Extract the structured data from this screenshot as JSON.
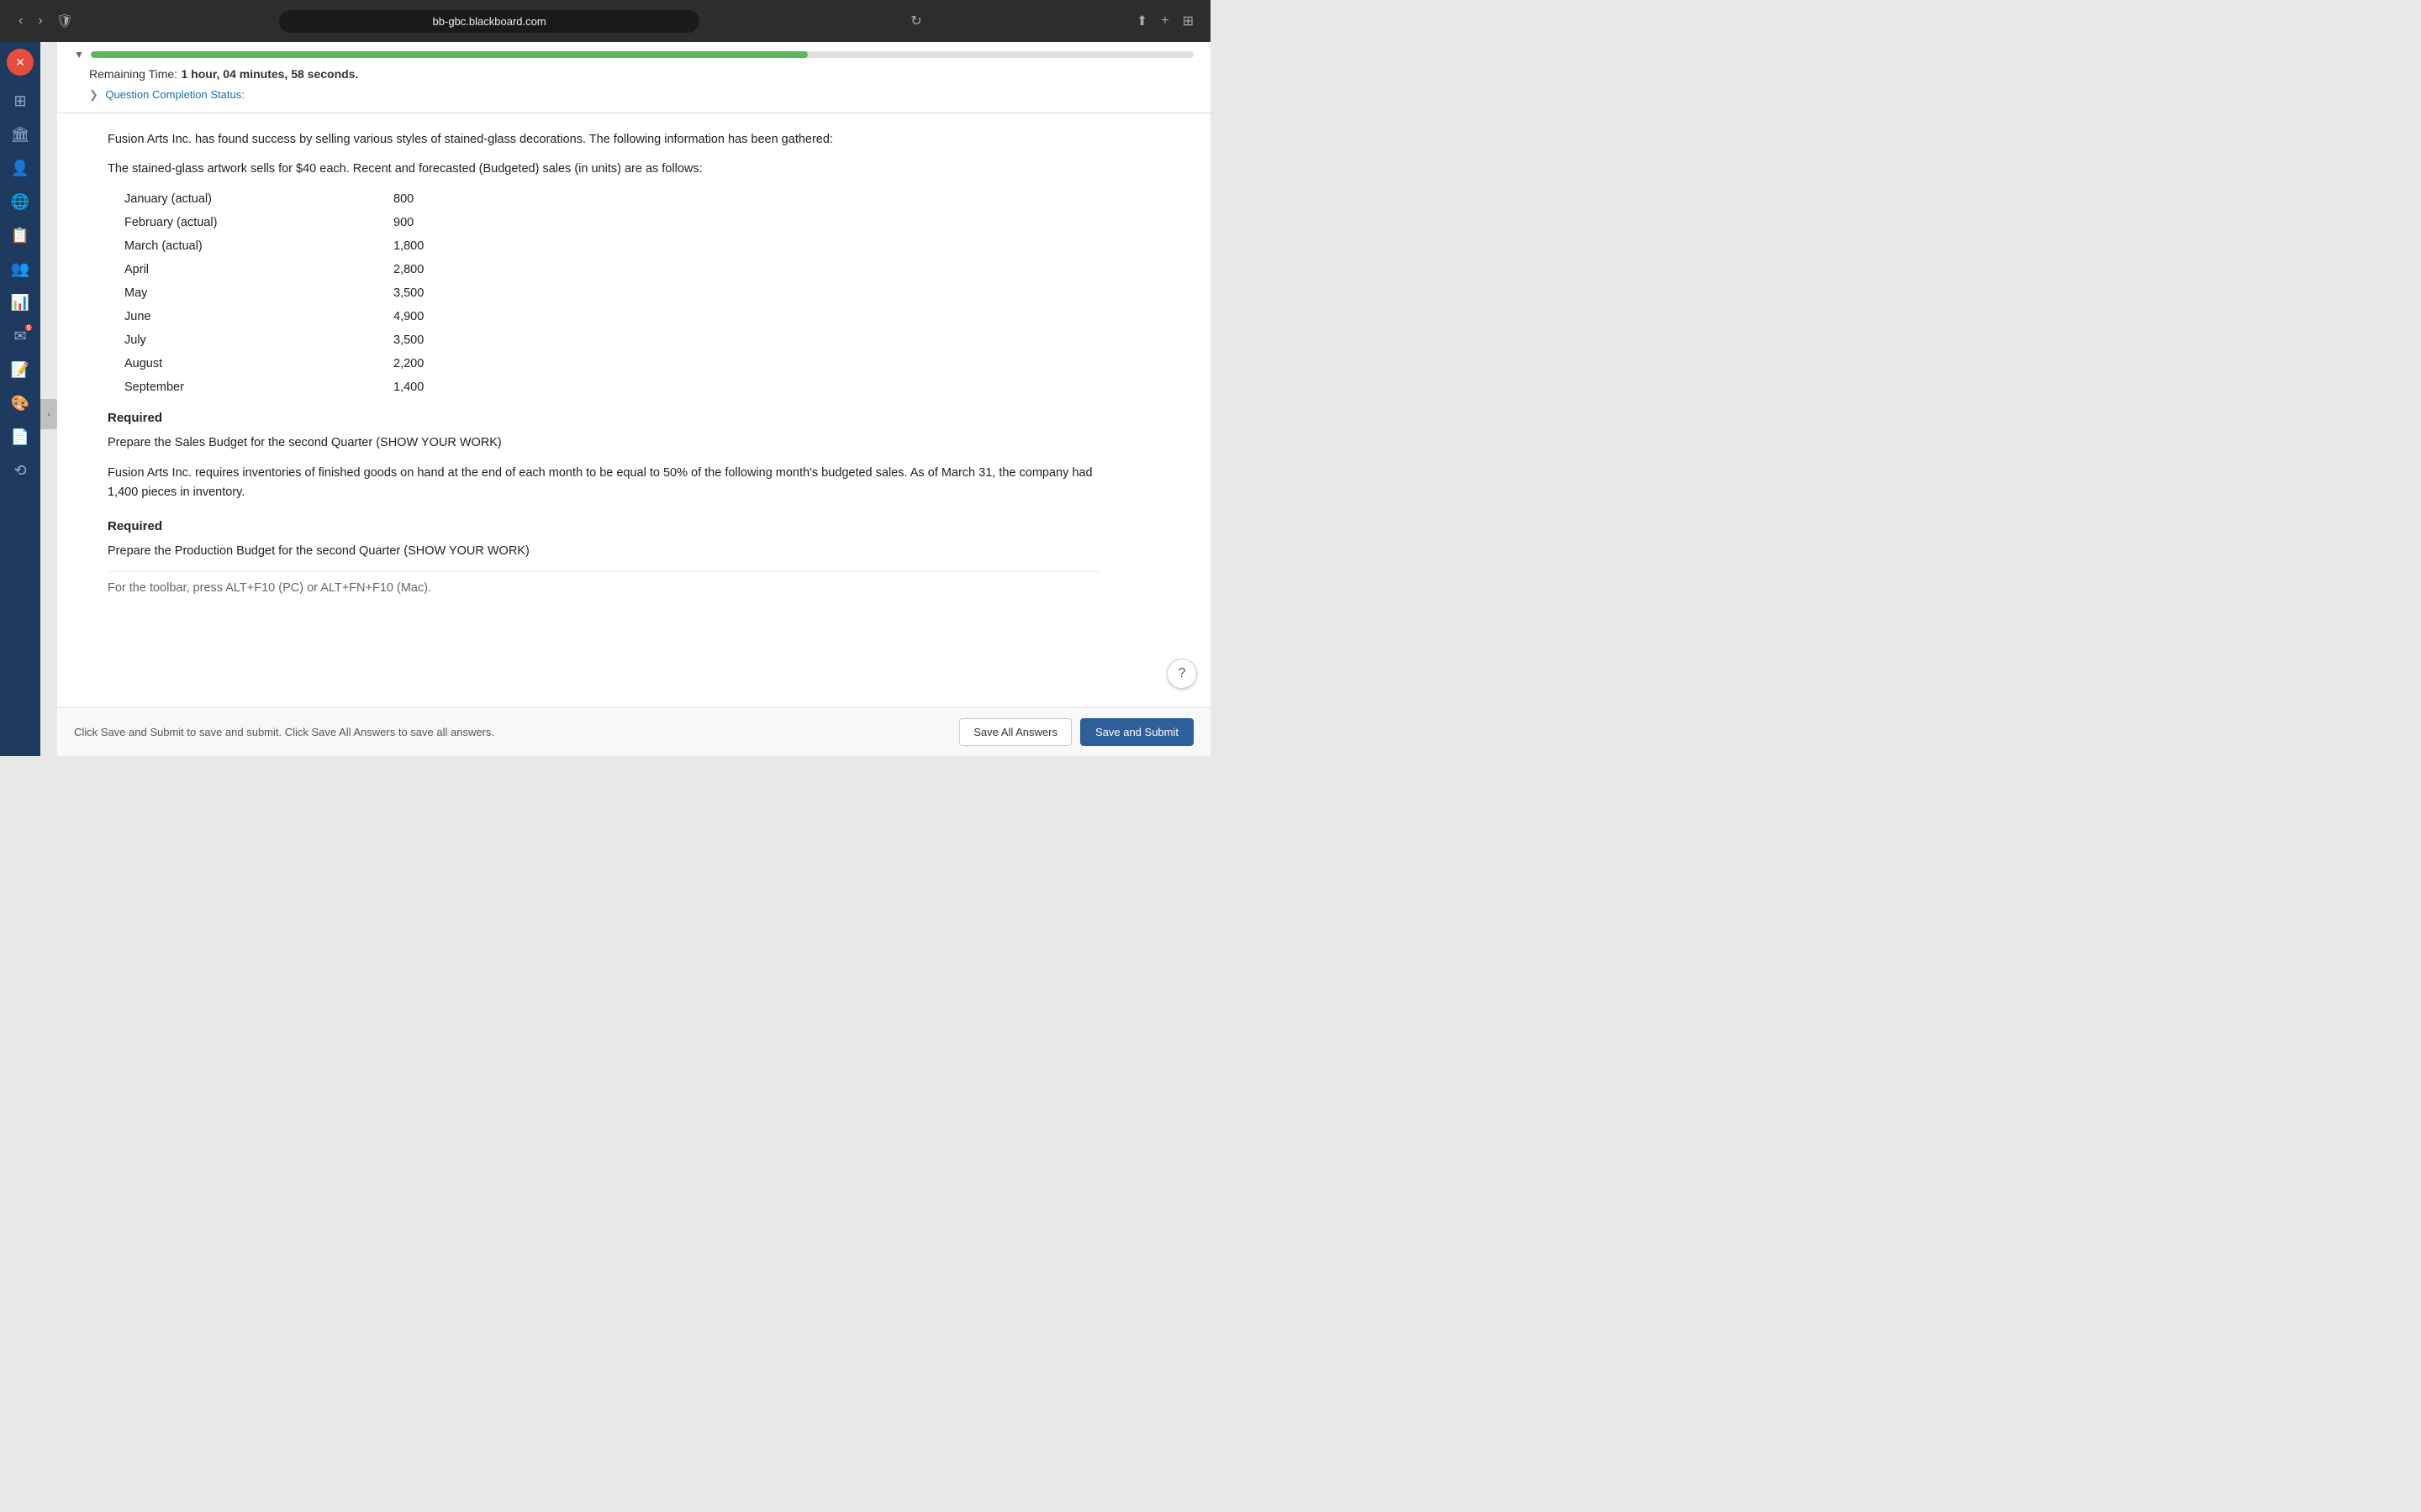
{
  "browser": {
    "back_btn": "‹",
    "forward_btn": "›",
    "url": "bb-gbc.blackboard.com",
    "shield_icon": "🛡",
    "reload_icon": "↻"
  },
  "timer": {
    "label": "Remaining Time:",
    "value": "1 hour, 04 minutes, 58 seconds.",
    "progress_pct": 65,
    "completion_label": "Question Completion Status:"
  },
  "question": {
    "intro": "Fusion Arts Inc. has found success by selling various styles of stained-glass decorations. The following information has been gathered:",
    "sales_intro": "The stained-glass artwork sells for $40 each. Recent and forecasted (Budgeted) sales (in units) are as follows:",
    "sales_data": [
      {
        "month": "January (actual)",
        "value": "800"
      },
      {
        "month": "February (actual)",
        "value": "900"
      },
      {
        "month": "March (actual)",
        "value": "1,800"
      },
      {
        "month": "April",
        "value": "2,800"
      },
      {
        "month": "May",
        "value": "3,500"
      },
      {
        "month": "June",
        "value": "4,900"
      },
      {
        "month": "July",
        "value": "3,500"
      },
      {
        "month": "August",
        "value": "2,200"
      },
      {
        "month": "September",
        "value": "1,400"
      }
    ],
    "required_1_label": "Required",
    "required_1_text": "Prepare the Sales Budget for the second Quarter   (SHOW YOUR WORK)",
    "inventory_note": "Fusion Arts Inc. requires inventories of finished goods on hand at the end of each month to be equal to 50% of the following month's budgeted sales. As of March 31, the company had 1,400 pieces in inventory.",
    "required_2_label": "Required",
    "required_2_text": "Prepare the Production Budget for the second Quarter  (SHOW YOUR WORK)",
    "partial_text": "For the toolbar, press ALT+F10 (PC) or ALT+FN+F10 (Mac)."
  },
  "footer": {
    "hint": "Click Save and Submit to save and submit. Click Save All Answers to save all answers.",
    "save_all_label": "Save All Answers",
    "save_submit_label": "Save and Submit"
  },
  "help": {
    "icon": "?"
  },
  "sidebar": {
    "icons": [
      "⊞",
      "🏛",
      "👤",
      "🌐",
      "📋",
      "👥",
      "📊",
      "✉",
      "📝",
      "🎨",
      "📄",
      "⟲"
    ]
  }
}
